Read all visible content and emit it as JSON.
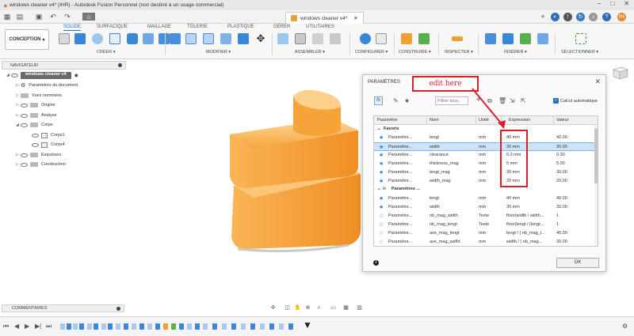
{
  "titlebar": {
    "title": "windows cleaner v4* (IHR) - Autodesk Fusion Personnel (non destiné à un usage commercial)"
  },
  "document_tab": {
    "label": "windows cleaner v4*"
  },
  "ribbon": {
    "workspace": "CONCEPTION",
    "tabs": [
      "SOLIDE",
      "SURFACIQUE",
      "MAILLAGE",
      "TÔLERIE",
      "PLASTIQUE",
      "GÉRER",
      "UTILITAIRES"
    ],
    "active_tab": "SOLIDE",
    "groups": [
      "CRÉER ▾",
      "MODIFIER ▾",
      "ASSEMBLER ▾",
      "CONFIGURER ▾",
      "CONSTRUIRE ▾",
      "INSPECTER ▾",
      "INSÉRER ▾",
      "SÉLECTIONNER ▾"
    ]
  },
  "navigator": {
    "title": "NAVIGATEUR",
    "root": "windows cleaner v4",
    "items": [
      "Paramètres du document",
      "Vues nommées",
      "Origine",
      "Analyse",
      "Corps",
      "Corps1",
      "Corps4",
      "Esquisses",
      "Construction"
    ]
  },
  "comments": {
    "title": "COMMENTAIRES"
  },
  "dialog": {
    "title": "PARAMÈTRES",
    "filter_placeholder": "Filtrer tous...",
    "autocalc_label": "Calcul automatique",
    "ok_label": "OK",
    "columns": [
      "Paramètre",
      "Nom",
      "Unité",
      "Expression",
      "Valeur"
    ],
    "sections": {
      "favoris": "Favoris",
      "params": "Paramètres ..."
    },
    "favoris_rows": [
      {
        "param": "Paramètre...",
        "name": "lengt",
        "unit": "mm",
        "expr": "40 mm",
        "value": "40.00",
        "selected": false
      },
      {
        "param": "Paramètre...",
        "name": "width",
        "unit": "mm",
        "expr": "30 mm",
        "value": "30.00",
        "selected": true
      },
      {
        "param": "Paramètre...",
        "name": "clearance",
        "unit": "mm",
        "expr": "0.3 mm",
        "value": "0.30",
        "selected": false
      },
      {
        "param": "Paramètre...",
        "name": "thickness_mag",
        "unit": "mm",
        "expr": "5 mm",
        "value": "5.00",
        "selected": false
      },
      {
        "param": "Paramètre...",
        "name": "lengt_mag",
        "unit": "mm",
        "expr": "30 mm",
        "value": "30.00",
        "selected": false
      },
      {
        "param": "Paramètre...",
        "name": "width_mag",
        "unit": "mm",
        "expr": "20 mm",
        "value": "20.00",
        "selected": false
      }
    ],
    "user_rows": [
      {
        "param": "Paramètre...",
        "name": "lengt",
        "unit": "mm",
        "expr": "40 mm",
        "value": "40.00",
        "star": "filled"
      },
      {
        "param": "Paramètre...",
        "name": "width",
        "unit": "mm",
        "expr": "30 mm",
        "value": "30.00",
        "star": "filled"
      },
      {
        "param": "Paramètre...",
        "name": "nb_mag_width",
        "unit": "Texte",
        "expr": "floor(width / width...",
        "value": "1",
        "star": "empty"
      },
      {
        "param": "Paramètre...",
        "name": "nb_mag_lengt",
        "unit": "Texte",
        "expr": "floor(lengt / (lengt...",
        "value": "1",
        "star": "empty"
      },
      {
        "param": "Paramètre...",
        "name": "axe_mag_lengt",
        "unit": "mm",
        "expr": "lengt / ( nb_mag_l...",
        "value": "40.00",
        "star": "empty"
      },
      {
        "param": "Paramètre...",
        "name": "axe_mag_widht",
        "unit": "mm",
        "expr": "width / ( nb_mag...",
        "value": "30.00",
        "star": "empty"
      }
    ]
  },
  "annotation": {
    "text": "edit here"
  },
  "colors": {
    "accent": "#2a7dd4",
    "annotation": "#d6202a",
    "body_part": "#f7a63a"
  }
}
